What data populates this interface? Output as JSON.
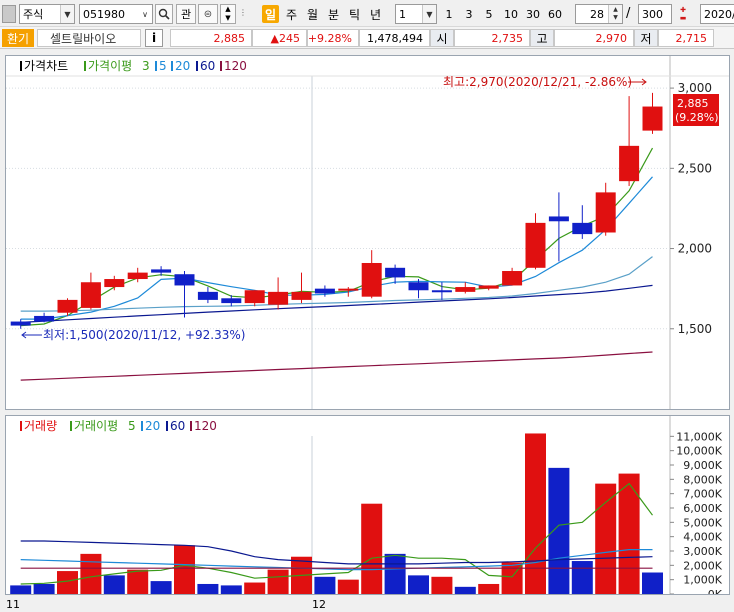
{
  "toolbar": {
    "market": "주식",
    "code": "051980",
    "interest_label": "관",
    "periods": [
      "일",
      "주",
      "월",
      "분",
      "틱",
      "년"
    ],
    "active_period": "일",
    "interval_value": "1",
    "quick_intervals": [
      "1",
      "3",
      "5",
      "10",
      "30",
      "60"
    ],
    "count_value": "28",
    "separator": "/",
    "total_count": "300",
    "date_value": "2020/"
  },
  "quote": {
    "tag": "환기",
    "name": "셀트릴바이오",
    "info_label": "i",
    "price": "2,885",
    "change": "▲245",
    "change_pct": "+9.28%",
    "volume": "1,478,494",
    "open_label": "시",
    "open": "2,735",
    "high_label": "고",
    "high": "2,970",
    "low_label": "저",
    "low": "2,715"
  },
  "colors": {
    "up": "#e01010",
    "down": "#1020c8",
    "ma5": "#3a9a1a",
    "ma20": "#1e8ad8",
    "ma60": "#0a1890",
    "ma120": "#8a1040"
  },
  "price_legend": {
    "title": "가격차트",
    "ma_label": "가격이평",
    "periods": [
      "3",
      "5",
      "20",
      "60",
      "120"
    ]
  },
  "volume_legend": {
    "title": "거래량",
    "ma_label": "거래이평",
    "periods": [
      "5",
      "20",
      "60",
      "120"
    ]
  },
  "annotations": {
    "high_note": "최고:2,970(2020/12/21, -2.86%)",
    "low_note": "최저:1,500(2020/11/12, +92.33%)",
    "current_price": "2,885",
    "current_pct": "(9.28%)"
  },
  "x_axis": {
    "labels": [
      "11",
      "12"
    ]
  },
  "chart_data": [
    {
      "type": "candlestick",
      "title": "가격차트",
      "ylim": [
        1000,
        3200
      ],
      "yticks": [
        "3,000",
        "2,500",
        "2,000",
        "1,500"
      ],
      "ytick_values": [
        3000,
        2500,
        2000,
        1500
      ],
      "candles": [
        {
          "o": 1545,
          "h": 1560,
          "l": 1500,
          "c": 1520
        },
        {
          "o": 1580,
          "h": 1600,
          "l": 1540,
          "c": 1545
        },
        {
          "o": 1600,
          "h": 1690,
          "l": 1580,
          "c": 1680
        },
        {
          "o": 1630,
          "h": 1850,
          "l": 1620,
          "c": 1790
        },
        {
          "o": 1760,
          "h": 1830,
          "l": 1740,
          "c": 1810
        },
        {
          "o": 1810,
          "h": 1880,
          "l": 1790,
          "c": 1850
        },
        {
          "o": 1870,
          "h": 1890,
          "l": 1830,
          "c": 1850
        },
        {
          "o": 1840,
          "h": 1860,
          "l": 1570,
          "c": 1770
        },
        {
          "o": 1730,
          "h": 1760,
          "l": 1660,
          "c": 1680
        },
        {
          "o": 1690,
          "h": 1710,
          "l": 1640,
          "c": 1660
        },
        {
          "o": 1660,
          "h": 1740,
          "l": 1640,
          "c": 1740
        },
        {
          "o": 1650,
          "h": 1820,
          "l": 1620,
          "c": 1730
        },
        {
          "o": 1680,
          "h": 1850,
          "l": 1660,
          "c": 1730
        },
        {
          "o": 1750,
          "h": 1770,
          "l": 1700,
          "c": 1720
        },
        {
          "o": 1740,
          "h": 1760,
          "l": 1700,
          "c": 1750
        },
        {
          "o": 1700,
          "h": 1990,
          "l": 1690,
          "c": 1910
        },
        {
          "o": 1880,
          "h": 1900,
          "l": 1780,
          "c": 1820
        },
        {
          "o": 1790,
          "h": 1810,
          "l": 1690,
          "c": 1740
        },
        {
          "o": 1740,
          "h": 1790,
          "l": 1680,
          "c": 1730
        },
        {
          "o": 1730,
          "h": 1790,
          "l": 1720,
          "c": 1760
        },
        {
          "o": 1750,
          "h": 1770,
          "l": 1740,
          "c": 1770
        },
        {
          "o": 1770,
          "h": 1880,
          "l": 1770,
          "c": 1860
        },
        {
          "o": 1880,
          "h": 2220,
          "l": 1870,
          "c": 2160
        },
        {
          "o": 2200,
          "h": 2350,
          "l": 1920,
          "c": 2170
        },
        {
          "o": 2160,
          "h": 2270,
          "l": 2060,
          "c": 2090
        },
        {
          "o": 2100,
          "h": 2410,
          "l": 2080,
          "c": 2350
        },
        {
          "o": 2420,
          "h": 2950,
          "l": 2390,
          "c": 2640
        },
        {
          "o": 2735,
          "h": 2970,
          "l": 2715,
          "c": 2885
        }
      ],
      "series": [
        {
          "name": "3",
          "color": "#3a9a1a",
          "values": [
            1520,
            1530,
            1582,
            1672,
            1760,
            1817,
            1837,
            1823,
            1767,
            1703,
            1693,
            1710,
            1733,
            1727,
            1733,
            1793,
            1827,
            1823,
            1763,
            1743,
            1753,
            1797,
            1930,
            2063,
            2140,
            2203,
            2360,
            2626
          ]
        },
        {
          "name": "5",
          "color": "#1e8ad8",
          "values": [
            1560,
            1560,
            1582,
            1604,
            1640,
            1692,
            1808,
            1816,
            1788,
            1762,
            1740,
            1710,
            1709,
            1714,
            1729,
            1764,
            1791,
            1796,
            1792,
            1790,
            1760,
            1772,
            1826,
            1912,
            1990,
            2118,
            2282,
            2447
          ]
        },
        {
          "name": "20",
          "color": "#5aa0c8",
          "values": [
            1610,
            1610,
            1612,
            1616,
            1622,
            1628,
            1634,
            1638,
            1640,
            1642,
            1646,
            1652,
            1656,
            1660,
            1664,
            1670,
            1676,
            1680,
            1684,
            1690,
            1695,
            1704,
            1720,
            1740,
            1760,
            1790,
            1840,
            1950
          ]
        },
        {
          "name": "60",
          "color": "#0a1890",
          "values": [
            1540,
            1548,
            1556,
            1564,
            1572,
            1580,
            1588,
            1596,
            1604,
            1611,
            1618,
            1625,
            1632,
            1638,
            1645,
            1652,
            1659,
            1666,
            1673,
            1680,
            1687,
            1695,
            1704,
            1713,
            1722,
            1735,
            1752,
            1770
          ]
        },
        {
          "name": "120",
          "color": "#8a1040",
          "values": [
            1180,
            1186,
            1192,
            1198,
            1204,
            1210,
            1216,
            1222,
            1228,
            1234,
            1240,
            1246,
            1252,
            1258,
            1264,
            1270,
            1276,
            1282,
            1288,
            1294,
            1300,
            1306,
            1312,
            1318,
            1326,
            1336,
            1346,
            1355
          ]
        }
      ]
    },
    {
      "type": "bar",
      "title": "거래량",
      "ylim": [
        0,
        12000
      ],
      "yticks": [
        "11,000K",
        "10,000K",
        "9,000K",
        "8,000K",
        "7,000K",
        "6,000K",
        "5,000K",
        "4,000K",
        "3,000K",
        "2,000K",
        "1,000K",
        "0K"
      ],
      "ytick_values": [
        11000,
        10000,
        9000,
        8000,
        7000,
        6000,
        5000,
        4000,
        3000,
        2000,
        1000,
        0
      ],
      "values": [
        600,
        700,
        1600,
        2800,
        1300,
        1700,
        900,
        3400,
        700,
        600,
        800,
        1700,
        2600,
        1200,
        1000,
        6300,
        2800,
        1300,
        1200,
        500,
        700,
        2200,
        11200,
        8800,
        2300,
        7700,
        8400,
        1500
      ],
      "up": [
        false,
        false,
        true,
        true,
        false,
        true,
        false,
        true,
        false,
        false,
        true,
        true,
        true,
        false,
        true,
        true,
        false,
        false,
        true,
        false,
        true,
        true,
        true,
        false,
        false,
        true,
        true,
        false
      ],
      "series": [
        {
          "name": "5",
          "color": "#3a9a1a",
          "values": [
            700,
            750,
            900,
            1200,
            1400,
            1600,
            1650,
            2000,
            1800,
            1500,
            1100,
            1200,
            1300,
            1400,
            1500,
            2500,
            2700,
            2500,
            2500,
            2400,
            1300,
            1200,
            3200,
            4800,
            5000,
            6400,
            7700,
            5500
          ]
        },
        {
          "name": "20",
          "color": "#1e8ad8",
          "values": [
            2400,
            2350,
            2300,
            2250,
            2200,
            2150,
            2100,
            2050,
            2000,
            1950,
            1900,
            1850,
            1800,
            1750,
            1700,
            1700,
            1750,
            1800,
            1850,
            1900,
            1950,
            2000,
            2200,
            2500,
            2700,
            2900,
            3100,
            3100
          ]
        },
        {
          "name": "60",
          "color": "#0a1890",
          "values": [
            3700,
            3700,
            3650,
            3600,
            3550,
            3500,
            3450,
            3400,
            3300,
            3000,
            2600,
            2400,
            2300,
            2200,
            2100,
            2100,
            2100,
            2100,
            2150,
            2200,
            2200,
            2250,
            2300,
            2400,
            2450,
            2500,
            2550,
            2600
          ]
        },
        {
          "name": "120",
          "color": "#8a1040",
          "values": [
            1800,
            1800,
            1800,
            1800,
            1800,
            1800,
            1800,
            1800,
            1800,
            1800,
            1800,
            1800,
            1800,
            1800,
            1800,
            1800,
            1800,
            1800,
            1800,
            1800,
            1800,
            1800,
            1800,
            1800,
            1800,
            1800,
            1800,
            1800
          ]
        }
      ]
    }
  ]
}
